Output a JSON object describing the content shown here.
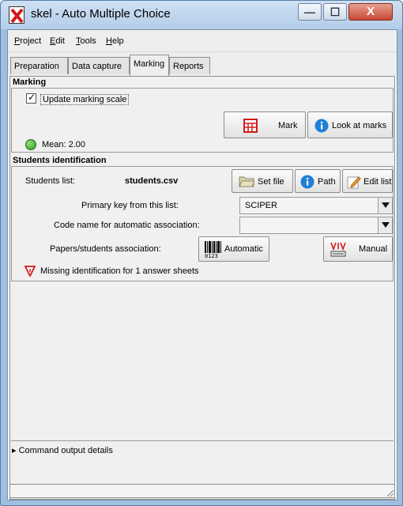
{
  "window": {
    "title": "skel - Auto Multiple Choice",
    "minimize_glyph": "—",
    "maximize_glyph": "☐",
    "close_glyph": "X"
  },
  "menu": {
    "items": [
      {
        "first": "P",
        "rest": "roject"
      },
      {
        "first": "E",
        "rest": "dit"
      },
      {
        "first": "T",
        "rest": "ools"
      },
      {
        "first": "H",
        "rest": "elp"
      }
    ]
  },
  "tabs": [
    "Preparation",
    "Data capture",
    "Marking",
    "Reports"
  ],
  "active_tab": "Marking",
  "marking": {
    "section_title": "Marking",
    "update_scale_label": "Update marking scale",
    "update_scale_checked": true,
    "check_glyph": "✓",
    "mark_button": "Mark",
    "look_button": "Look at marks",
    "mean_text": "Mean: 2.00"
  },
  "students": {
    "section_title": "Students identification",
    "list_label": "Students list:",
    "list_file": "students.csv",
    "set_file_button": "Set file",
    "path_button": "Path",
    "edit_list_button": "Edit list",
    "primary_key_label": "Primary key from this list:",
    "primary_key_value": "SCIPER",
    "code_name_label": "Code name for automatic association:",
    "code_name_value": "",
    "association_label": "Papers/students association:",
    "automatic_button": "Automatic",
    "barcode_digits": "0123",
    "manual_button": "Manual",
    "warning_text": "Missing identification for 1 answer sheets"
  },
  "command_output": {
    "expander_glyph": "▸",
    "label": "Command output details"
  },
  "colors": {
    "accent_blue": "#1f7fd6",
    "warning_red": "#d62b2b",
    "ok_green": "#34a826"
  }
}
